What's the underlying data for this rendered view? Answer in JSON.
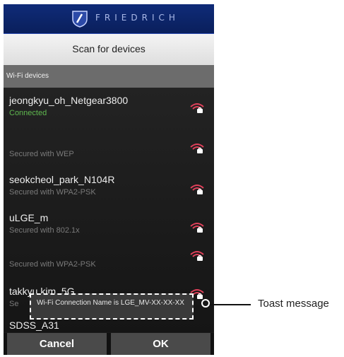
{
  "brand": {
    "name": "FRIEDRICH"
  },
  "header": {
    "title": "Scan for devices"
  },
  "section": {
    "label": "Wi-Fi devices"
  },
  "networks": [
    {
      "ssid": "jeongkyu_oh_Netgear3800",
      "status": "Connected",
      "status_type": "connected"
    },
    {
      "ssid": "",
      "status": "Secured with WEP",
      "status_type": "secured"
    },
    {
      "ssid": "seokcheol_park_N104R",
      "status": "Secured with WPA2-PSK",
      "status_type": "secured"
    },
    {
      "ssid": "uLGE_m",
      "status": "Secured with 802.1x",
      "status_type": "secured"
    },
    {
      "ssid": "",
      "status": "Secured with WPA2-PSK",
      "status_type": "secured"
    },
    {
      "ssid": "takkyu.kim_5G",
      "status": "Se",
      "status_type": "secured"
    },
    {
      "ssid": "SDSS_A31",
      "status": "",
      "status_type": "secured"
    }
  ],
  "toast": {
    "text": "Wi-Fi Connection Name is LGE_MV-XX-XX-XX"
  },
  "buttons": {
    "cancel": "Cancel",
    "ok": "OK"
  },
  "annotation": {
    "label": "Toast message"
  },
  "colors": {
    "brand_bg": "#0f2b78",
    "connected": "#5fb84f",
    "wifi_icon": "#e0405a"
  }
}
